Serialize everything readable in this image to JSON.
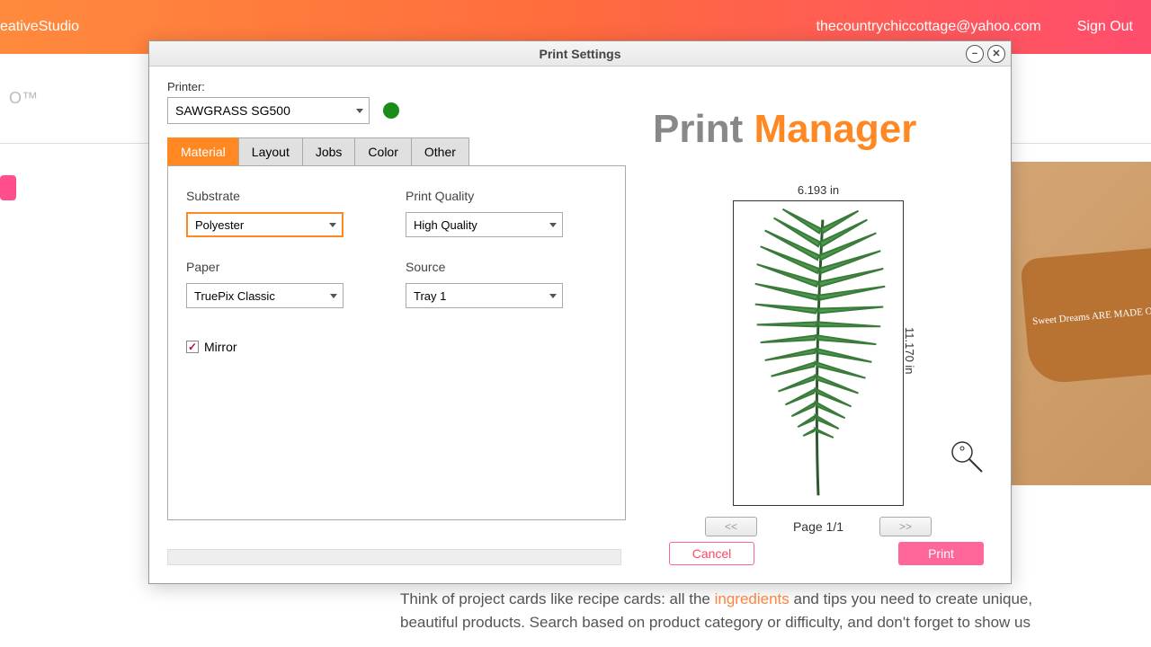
{
  "topbar": {
    "app": "eativeStudio",
    "email": "thecountrychiccottage@yahoo.com",
    "signout": "Sign Out"
  },
  "subbar": {
    "logo": "O™"
  },
  "dialog": {
    "title": "Print Settings",
    "printer_label": "Printer:",
    "printer_value": "SAWGRASS SG500",
    "tabs": [
      "Material",
      "Layout",
      "Jobs",
      "Color",
      "Other"
    ],
    "active_tab": 0,
    "fields": {
      "substrate_label": "Substrate",
      "substrate_value": "Polyester",
      "quality_label": "Print Quality",
      "quality_value": "High Quality",
      "paper_label": "Paper",
      "paper_value": "TruePix Classic",
      "source_label": "Source",
      "source_value": "Tray 1",
      "mirror_label": "Mirror",
      "mirror_checked": true
    },
    "app_title_1": "Print ",
    "app_title_2": "Manager",
    "preview": {
      "width_label": "6.193 in",
      "height_label": "11.170 in",
      "prev": "<<",
      "next": ">>",
      "page": "Page 1/1"
    },
    "cancel": "Cancel",
    "print": "Print"
  },
  "bg": {
    "board": "Sweet Dreams ARE MADE OF CHEESE",
    "text1": "Think of project cards like recipe cards: all the ",
    "text2": "ingredients",
    "text3": " and tips you need to create unique, beautiful products. Search based on product category or difficulty, and don't forget to show us"
  }
}
